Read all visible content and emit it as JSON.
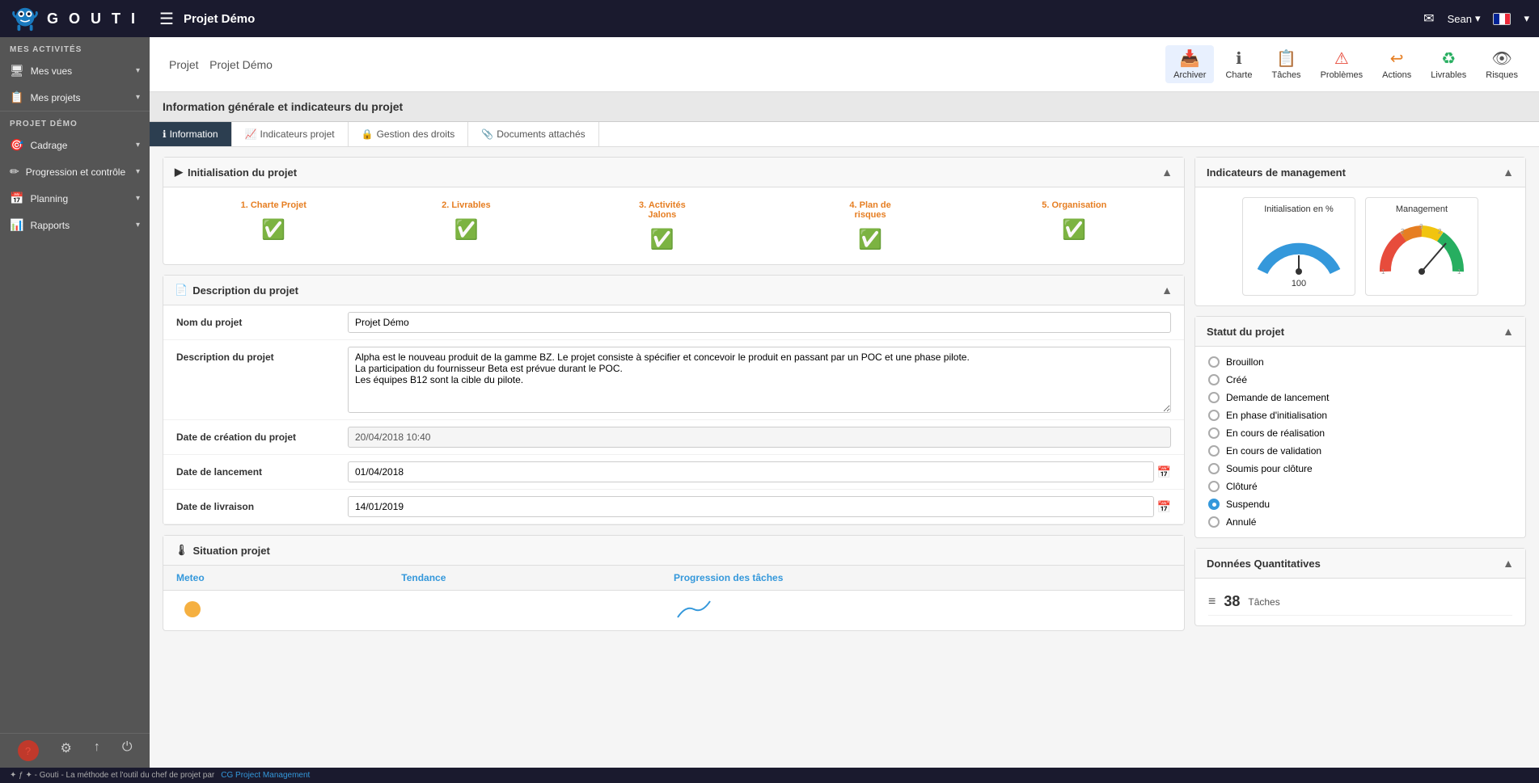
{
  "navbar": {
    "logo_text": "G O U T I",
    "page_title": "Projet Démo",
    "user_name": "Sean",
    "mail_icon": "✉",
    "hamburger": "☰"
  },
  "sidebar": {
    "mes_activites_label": "MES ACTIVITÉS",
    "items": [
      {
        "id": "mes-vues",
        "label": "Mes vues",
        "icon": "🖥",
        "has_arrow": true
      },
      {
        "id": "mes-projets",
        "label": "Mes projets",
        "icon": "📋",
        "has_arrow": true
      }
    ],
    "projet_label": "PROJET DÉMO",
    "projet_items": [
      {
        "id": "cadrage",
        "label": "Cadrage",
        "icon": "🎯",
        "has_arrow": true
      },
      {
        "id": "progression",
        "label": "Progression et contrôle",
        "icon": "✏",
        "has_arrow": true
      },
      {
        "id": "planning",
        "label": "Planning",
        "icon": "📅",
        "has_arrow": true
      },
      {
        "id": "rapports",
        "label": "Rapports",
        "icon": "📊",
        "has_arrow": true
      }
    ],
    "footer_icons": [
      "?",
      "⚙",
      "↑",
      "⏻"
    ]
  },
  "toolbar": {
    "buttons": [
      {
        "id": "archiver",
        "label": "Archiver",
        "icon": "📥"
      },
      {
        "id": "charte",
        "label": "Charte",
        "icon": "ℹ"
      },
      {
        "id": "taches",
        "label": "Tâches",
        "icon": "📋"
      },
      {
        "id": "problemes",
        "label": "Problèmes",
        "icon": "⚠"
      },
      {
        "id": "actions",
        "label": "Actions",
        "icon": "↩"
      },
      {
        "id": "livrables",
        "label": "Livrables",
        "icon": "♻"
      },
      {
        "id": "risques",
        "label": "Risques",
        "icon": "👁"
      }
    ]
  },
  "page": {
    "title": "Projet",
    "subtitle": "Projet Démo"
  },
  "info_section": {
    "title": "Information générale et indicateurs du projet"
  },
  "tabs": [
    {
      "id": "information",
      "label": "Information",
      "icon": "ℹ",
      "active": true
    },
    {
      "id": "indicateurs",
      "label": "Indicateurs projet",
      "icon": "📈",
      "active": false
    },
    {
      "id": "gestion-droits",
      "label": "Gestion des droits",
      "icon": "🔒",
      "active": false
    },
    {
      "id": "documents",
      "label": "Documents attachés",
      "icon": "📎",
      "active": false
    }
  ],
  "initialisation": {
    "title": "Initialisation du projet",
    "steps": [
      {
        "id": "charte",
        "label": "1. Charte Projet",
        "checked": true
      },
      {
        "id": "livrables",
        "label": "2. Livrables",
        "checked": true
      },
      {
        "id": "activites",
        "label": "3. Activités Jalons",
        "checked": true
      },
      {
        "id": "plan-risques",
        "label": "4. Plan de risques",
        "checked": true
      },
      {
        "id": "organisation",
        "label": "5. Organisation",
        "checked": true
      }
    ]
  },
  "description": {
    "title": "Description du projet",
    "fields": {
      "nom_label": "Nom du projet",
      "nom_value": "Projet Démo",
      "desc_label": "Description du projet",
      "desc_value": "Alpha est le nouveau produit de la gamme BZ. Le projet consiste à spécifier et concevoir le produit en passant par un POC et une phase pilote.\nLa participation du fournisseur Beta est prévue durant le POC.\nLes équipes B12 sont la cible du pilote.",
      "date_creation_label": "Date de création du projet",
      "date_creation_value": "20/04/2018 10:40",
      "date_lancement_label": "Date de lancement",
      "date_lancement_value": "01/04/2018",
      "date_livraison_label": "Date de livraison",
      "date_livraison_value": "14/01/2019"
    }
  },
  "situation": {
    "title": "Situation projet",
    "columns": [
      "Meteo",
      "Tendance",
      "Progression des tâches"
    ]
  },
  "indicateurs_management": {
    "title": "Indicateurs de management",
    "gauges": [
      {
        "id": "initialisation",
        "title": "Initialisation en %",
        "value": 100,
        "label": "100"
      },
      {
        "id": "management",
        "title": "Management",
        "value": 75
      }
    ]
  },
  "statut": {
    "title": "Statut du projet",
    "items": [
      {
        "id": "brouillon",
        "label": "Brouillon",
        "selected": false
      },
      {
        "id": "cree",
        "label": "Créé",
        "selected": false
      },
      {
        "id": "demande-lancement",
        "label": "Demande de lancement",
        "selected": false
      },
      {
        "id": "phase-init",
        "label": "En phase d'initialisation",
        "selected": false
      },
      {
        "id": "cours-realisation",
        "label": "En cours de réalisation",
        "selected": false
      },
      {
        "id": "cours-validation",
        "label": "En cours de validation",
        "selected": false
      },
      {
        "id": "soumis-cloture",
        "label": "Soumis pour clôture",
        "selected": false
      },
      {
        "id": "cloture",
        "label": "Clôturé",
        "selected": false
      },
      {
        "id": "suspendu",
        "label": "Suspendu",
        "selected": true
      },
      {
        "id": "annule",
        "label": "Annulé",
        "selected": false
      }
    ]
  },
  "donnees": {
    "title": "Données Quantitatives",
    "items": [
      {
        "id": "taches",
        "icon": "≡",
        "count": "38",
        "label": "Tâches"
      }
    ]
  },
  "bottom_bar": {
    "text": "✦ ƒ ✦ - Gouti - La méthode et l'outil du chef de projet par",
    "link_text": "CG Project Management",
    "link_href": "#"
  }
}
